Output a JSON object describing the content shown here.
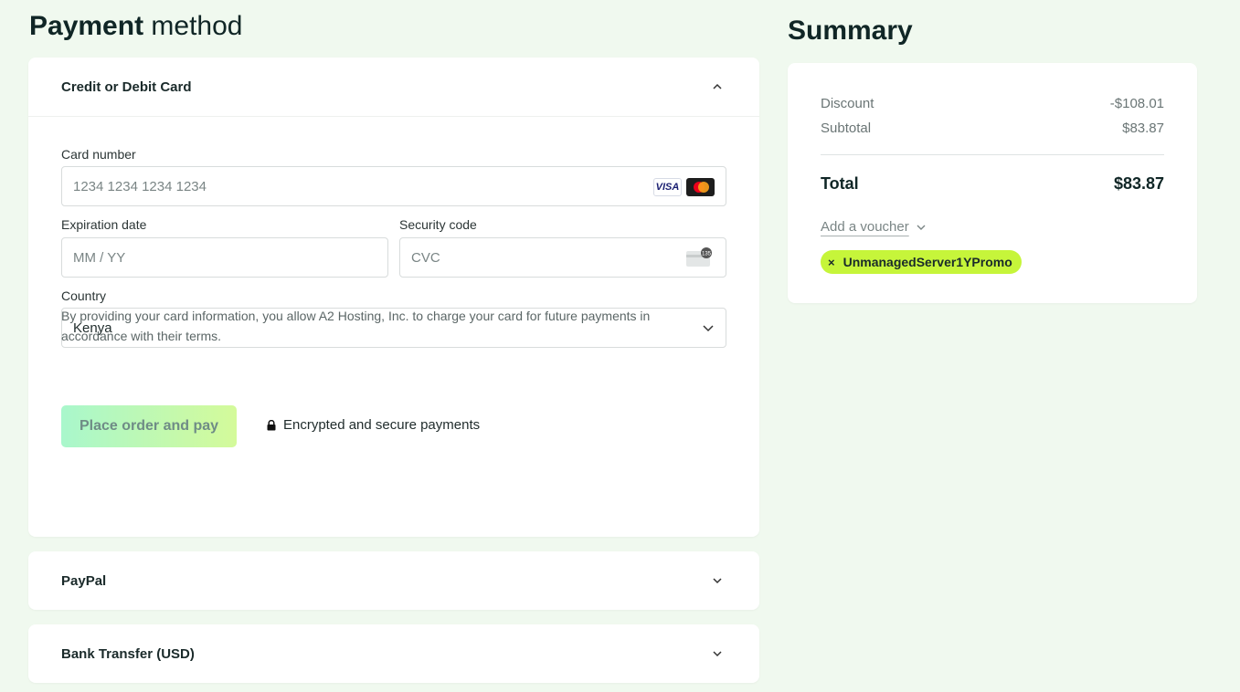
{
  "payment": {
    "title_bold": "Payment",
    "title_light": "method",
    "card_section": {
      "title": "Credit or Debit Card",
      "card_number_label": "Card number",
      "card_number_placeholder": "1234 1234 1234 1234",
      "brand_visa": "VISA",
      "expiry_label": "Expiration date",
      "expiry_placeholder": "MM / YY",
      "security_label": "Security code",
      "security_placeholder": "CVC",
      "cvc_icon_text": "135",
      "country_label": "Country",
      "country_value": "Kenya",
      "terms": "By providing your card information, you allow A2 Hosting, Inc. to charge your card for future payments in accordance with their terms.",
      "pay_button": "Place order and pay",
      "secure_text": "Encrypted and secure payments"
    },
    "paypal_title": "PayPal",
    "bank_title": "Bank Transfer (USD)"
  },
  "summary": {
    "title": "Summary",
    "discount_label": "Discount",
    "discount_value": "-$108.01",
    "subtotal_label": "Subtotal",
    "subtotal_value": "$83.87",
    "total_label": "Total",
    "total_value": "$83.87",
    "voucher_label": "Add a voucher",
    "applied_voucher": "UnmanagedServer1YPromo",
    "remove_symbol": "×"
  },
  "colors": {
    "background": "#f0f9ef",
    "voucher_chip": "#c6f53a",
    "pay_gradient_start": "#a9f7cc",
    "pay_gradient_end": "#d4fa9a"
  },
  "icons": [
    "chevron-up-icon",
    "chevron-down-icon",
    "visa-icon",
    "mastercard-icon",
    "cvc-card-icon",
    "lock-icon",
    "close-icon"
  ]
}
